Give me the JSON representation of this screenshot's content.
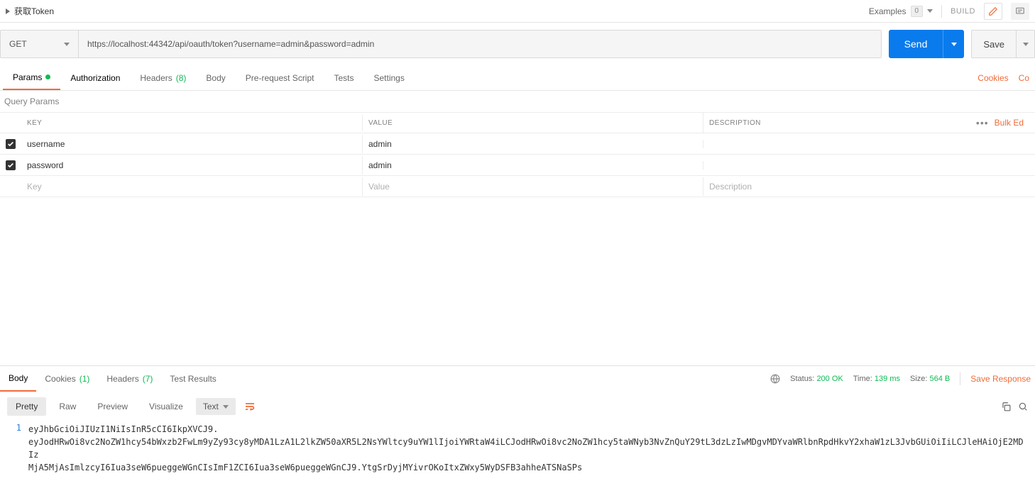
{
  "topbar": {
    "title": "获取Token",
    "examples_label": "Examples",
    "examples_count": "0",
    "build_label": "BUILD"
  },
  "request": {
    "method": "GET",
    "url": "https://localhost:44342/api/oauth/token?username=admin&password=admin",
    "send_label": "Send",
    "save_label": "Save"
  },
  "req_tabs": {
    "params": "Params",
    "authorization": "Authorization",
    "headers": "Headers",
    "headers_count": "(8)",
    "body": "Body",
    "prerequest": "Pre-request Script",
    "tests": "Tests",
    "settings": "Settings",
    "cookies_link": "Cookies",
    "code_link": "Co"
  },
  "query_section_label": "Query Params",
  "table": {
    "head_key": "Key",
    "head_value": "Value",
    "head_desc": "Description",
    "bulk_edit": "Bulk Ed",
    "rows": [
      {
        "key": "username",
        "value": "admin",
        "desc": ""
      },
      {
        "key": "password",
        "value": "admin",
        "desc": ""
      }
    ],
    "placeholder_key": "Key",
    "placeholder_value": "Value",
    "placeholder_desc": "Description"
  },
  "response": {
    "tabs": {
      "body": "Body",
      "cookies": "Cookies",
      "cookies_count": "(1)",
      "headers": "Headers",
      "headers_count": "(7)",
      "test_results": "Test Results"
    },
    "meta": {
      "status_label": "Status:",
      "status_value": "200 OK",
      "time_label": "Time:",
      "time_value": "139 ms",
      "size_label": "Size:",
      "size_value": "564 B",
      "save_response": "Save Response"
    },
    "body_toolbar": {
      "pretty": "Pretty",
      "raw": "Raw",
      "preview": "Preview",
      "visualize": "Visualize",
      "format": "Text"
    },
    "body_line_no": "1",
    "body_text": "eyJhbGciOiJIUzI1NiIsInR5cCI6IkpXVCJ9.\neyJodHRwOi8vc2NoZW1hcy54bWxzb2FwLm9yZy93cy8yMDA1LzA1L2lkZW50aXR5L2NsYWltcy9uYW1lIjoiYWRtaW4iLCJodHRwOi8vc2NoZW1hcy5taWNyb3NvZnQuY29tL3dzLzIwMDgvMDYvaWRlbnRpdHkvY2xhaW1zL3JvbGUiOiIiLCJleHAiOjE2MDIz\nMjA5MjAsImlzcyI6Iua3seW6pueggeWGnCIsImF1ZCI6Iua3seW6pueggeWGnCJ9.YtgSrDyjMYivrOKoItxZWxy5WyDSFB3ahheATSNaSPs"
  }
}
